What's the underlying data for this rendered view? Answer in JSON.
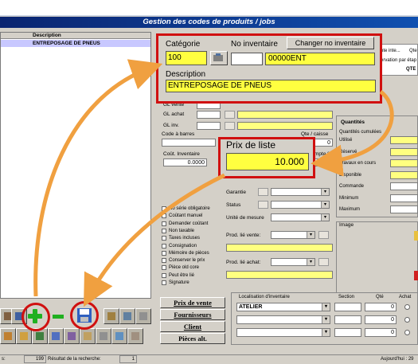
{
  "window": {
    "title": "Gestion des codes de produits / jobs"
  },
  "left_panel": {
    "header": "Description",
    "selected": "ENTREPOSAGE DE PNEUS"
  },
  "popup_top": {
    "categorie_label": "Catégorie",
    "categorie_value": "100",
    "no_inventaire_label": "No inventaire",
    "no_inventaire_value": "00000ENT",
    "change_button": "Changer no inventaire",
    "description_label": "Description",
    "description_value": "ENTREPOSAGE DE PNEUS"
  },
  "popup_price": {
    "label": "Prix de liste",
    "value": "10.000"
  },
  "fields": {
    "gl_vente": "GL vente",
    "gl_achat": "GL achat",
    "gl_inv": "GL inv.",
    "code_barres": "Code à barres",
    "qte_caisse": "Qte / caisse",
    "qte_caisse_val": "0",
    "cout_inventaire": "Coût. Inventaire",
    "cout_inventaire_val": "0.0000",
    "compte": "mpte %",
    "garantie": "Garantie",
    "status": "Status",
    "unite_mesure": "Unité de mesure",
    "prod_lie_vente": "Prod. lié vente:",
    "prod_lie_achat": "Prod. lié achat:"
  },
  "right_top": {
    "ote_inte": "ote inte...",
    "qte": "Qte",
    "reservation": "ervation par étap",
    "col_qte": "QTE"
  },
  "checkboxes": [
    "No série obligatoire",
    "Coûtant manuel",
    "Demander coûtant",
    "Non taxable",
    "Taxes incluses",
    "Consignation",
    "Mémoire de pièces",
    "Conserver le prix",
    "Pièce old core",
    "Peut être lié",
    "Signature"
  ],
  "quantities": {
    "title": "Quantités",
    "subtitle": "Quantités cumulées",
    "rows": [
      "Utilisé",
      "Réservé",
      "Travaux en cours",
      "Disponible",
      "Commande",
      "Minimum",
      "Maximum"
    ]
  },
  "image_section": {
    "label": "Image"
  },
  "side_buttons": [
    "Prix de vente",
    "Fournisseurs",
    "Client",
    "Pièces alt."
  ],
  "inventory_location": {
    "headers": [
      "Localisation d'inventaire",
      "Section",
      "Qté",
      "Achat"
    ],
    "rows": [
      {
        "location": "ATELIER",
        "section": "",
        "qty": "0"
      },
      {
        "location": "",
        "section": "",
        "qty": "0"
      },
      {
        "location": "",
        "section": "",
        "qty": "0"
      }
    ]
  },
  "status_bar": {
    "count_label": "s:",
    "count": "199",
    "result_label": "Résultat de la recherche:",
    "result": "1",
    "today": "Aujourd'hui : 29"
  },
  "colors": {
    "title_bg": "#003080",
    "highlight_red": "#d01010",
    "yellow_field": "#ffff80",
    "arrow": "#f0a040"
  }
}
